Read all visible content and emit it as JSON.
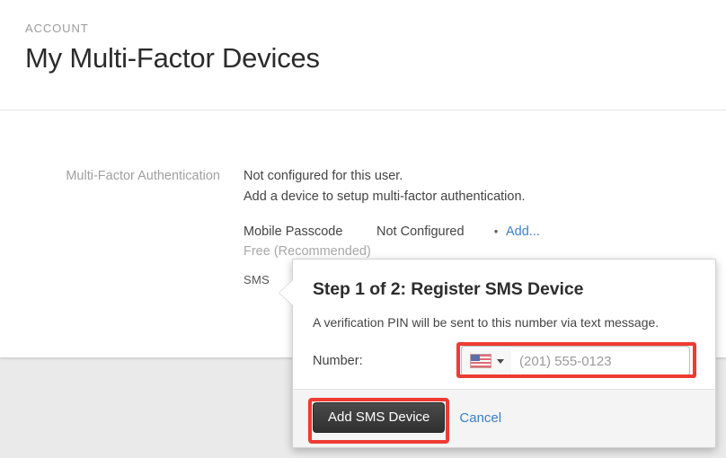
{
  "header": {
    "eyebrow": "ACCOUNT",
    "title": "My Multi-Factor Devices"
  },
  "main": {
    "field_label": "Multi-Factor Authentication",
    "status_line_1": "Not configured for this user.",
    "status_line_2": "Add a device to setup multi-factor authentication.",
    "devices": [
      {
        "name": "Mobile Passcode",
        "state": "Not Configured",
        "separator": "•",
        "action_label": "Add...",
        "sublabel": "Free (Recommended)"
      },
      {
        "name": "SMS",
        "state": "",
        "separator": "",
        "action_label": "",
        "sublabel": ""
      }
    ]
  },
  "popover": {
    "title": "Step 1 of 2: Register SMS Device",
    "description": "A verification PIN will be sent to this number via text message.",
    "number_label": "Number:",
    "number_value": "",
    "number_placeholder": "(201) 555-0123",
    "country_flag": "us-flag-icon",
    "country_caret": "chevron-down-icon",
    "submit_label": "Add SMS Device",
    "cancel_label": "Cancel"
  },
  "colors": {
    "accent_link": "#3b7fc4",
    "annotation_red": "#ee3b33",
    "primary_button": "#3a3a3a",
    "page_background": "#eaeaea",
    "card_background": "#ffffff"
  }
}
